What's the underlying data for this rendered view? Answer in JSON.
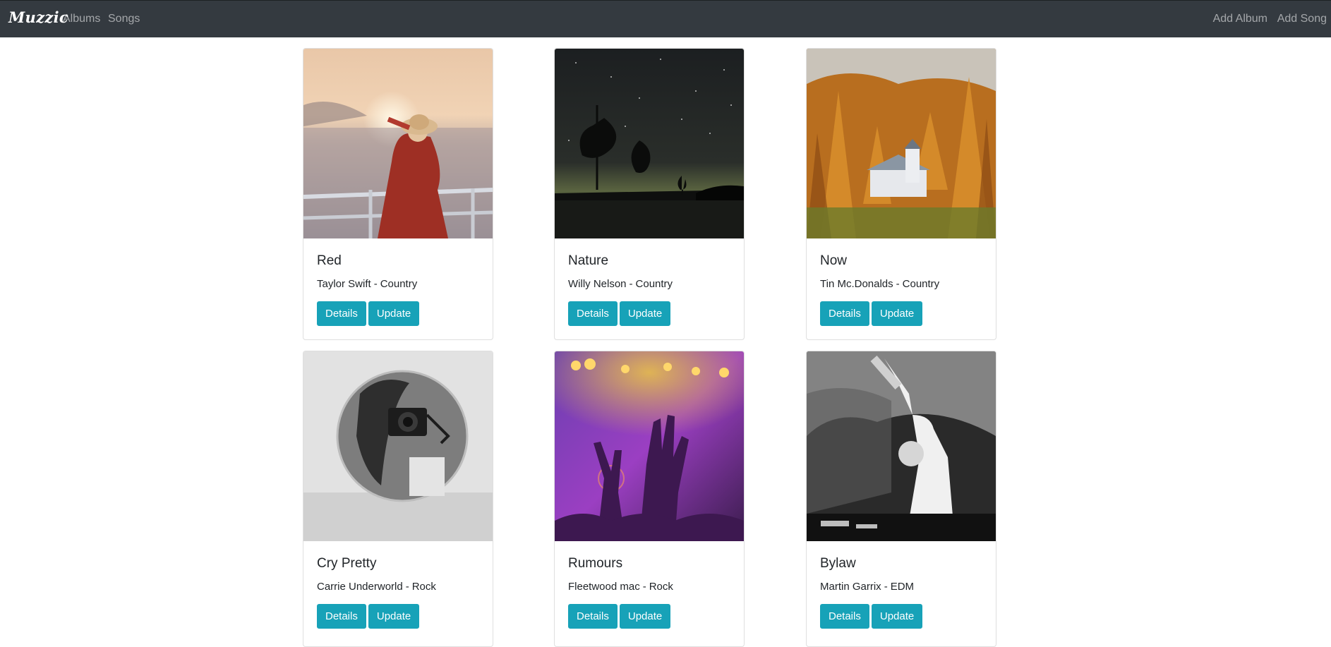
{
  "navbar": {
    "brand": "Muzzic",
    "links": {
      "albums": "Albums",
      "songs": "Songs",
      "add_album": "Add Album",
      "add_song": "Add Song"
    },
    "background": "#343a40"
  },
  "colors": {
    "button": "#17a2b8"
  },
  "albums": [
    {
      "title": "Red",
      "artist": "Taylor Swift",
      "genre": "Country",
      "details_label": "Details",
      "update_label": "Update"
    },
    {
      "title": "Nature",
      "artist": "Willy Nelson",
      "genre": "Country",
      "details_label": "Details",
      "update_label": "Update"
    },
    {
      "title": "Now",
      "artist": "Tin Mc.Donalds",
      "genre": "Country",
      "details_label": "Details",
      "update_label": "Update"
    },
    {
      "title": "Cry Pretty",
      "artist": "Carrie Underworld",
      "genre": "Rock",
      "details_label": "Details",
      "update_label": "Update"
    },
    {
      "title": "Rumours",
      "artist": "Fleetwood mac",
      "genre": "Rock",
      "details_label": "Details",
      "update_label": "Update"
    },
    {
      "title": "Bylaw",
      "artist": "Martin Garrix",
      "genre": "EDM",
      "details_label": "Details",
      "update_label": "Update"
    }
  ]
}
